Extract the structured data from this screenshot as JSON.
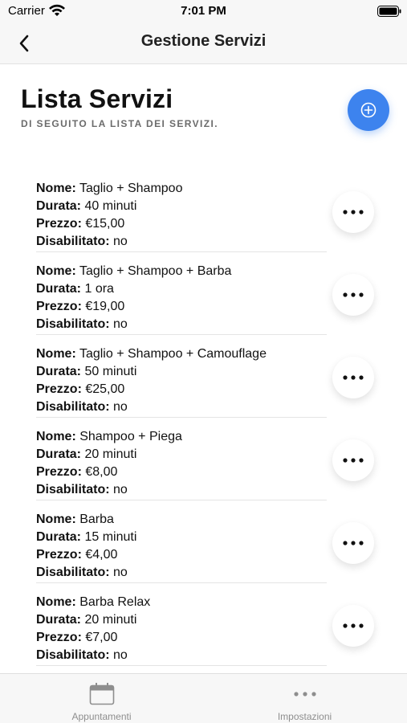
{
  "status_bar": {
    "carrier": "Carrier",
    "time": "7:01 PM"
  },
  "nav": {
    "title": "Gestione Servizi"
  },
  "header": {
    "title": "Lista Servizi",
    "subtitle": "DI SEGUITO LA LISTA DEI SERVIZI."
  },
  "labels": {
    "name": "Nome:",
    "duration": "Durata:",
    "price": "Prezzo:",
    "disabled": "Disabilitato:"
  },
  "services": [
    {
      "name": "Taglio + Shampoo",
      "duration": "40 minuti",
      "price": "€15,00",
      "disabled": "no"
    },
    {
      "name": "Taglio + Shampoo + Barba",
      "duration": "1 ora",
      "price": "€19,00",
      "disabled": "no"
    },
    {
      "name": "Taglio + Shampoo + Camouflage",
      "duration": "50 minuti",
      "price": "€25,00",
      "disabled": "no"
    },
    {
      "name": "Shampoo + Piega",
      "duration": "20 minuti",
      "price": "€8,00",
      "disabled": "no"
    },
    {
      "name": "Barba",
      "duration": "15 minuti",
      "price": "€4,00",
      "disabled": "no"
    },
    {
      "name": "Barba Relax",
      "duration": "20 minuti",
      "price": "€7,00",
      "disabled": "no"
    }
  ],
  "tabs": [
    {
      "label": "Appuntamenti",
      "icon": "calendar-icon"
    },
    {
      "label": "Impostazioni",
      "icon": "more-horizontal-icon"
    }
  ],
  "colors": {
    "accent": "#3d83ee",
    "tab_inactive": "#8e8e8e",
    "bar_background": "#f7f7f7"
  }
}
